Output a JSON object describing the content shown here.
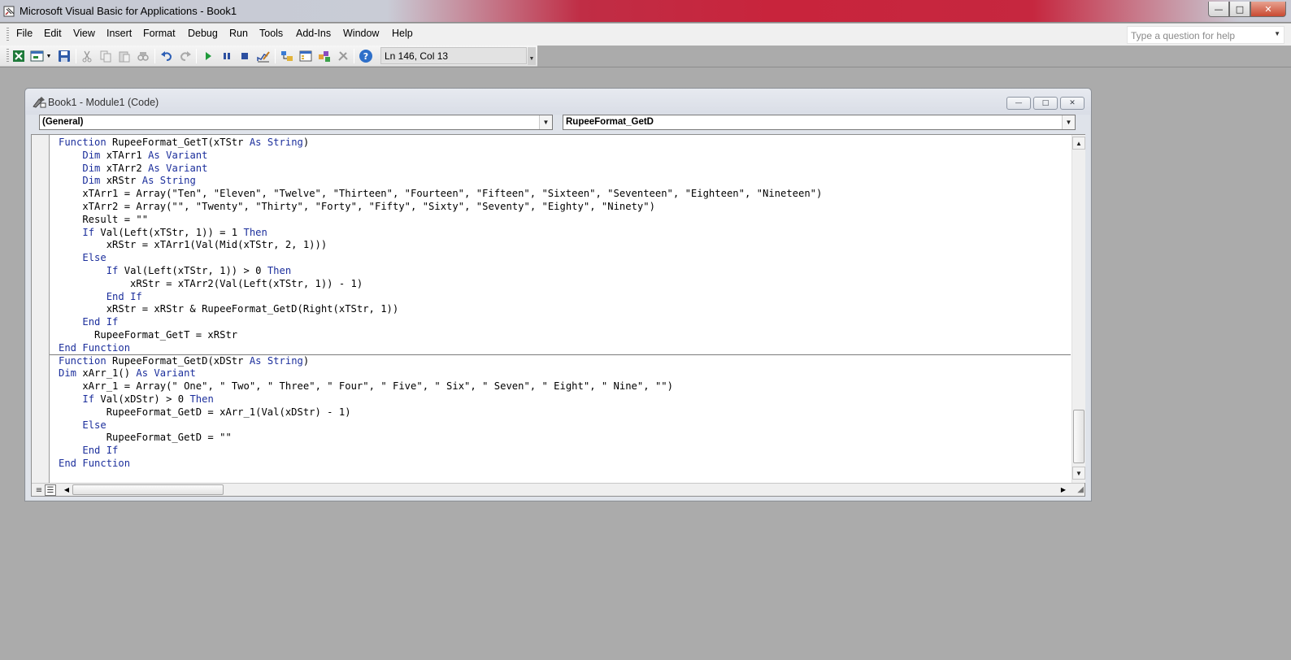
{
  "window": {
    "title": "Microsoft Visual Basic for Applications - Book1",
    "minimize_glyph": "—",
    "maximize_glyph": "□",
    "close_glyph": "✕"
  },
  "menu": {
    "items": [
      "File",
      "Edit",
      "View",
      "Insert",
      "Format",
      "Debug",
      "Run",
      "Tools",
      "Add-Ins",
      "Window",
      "Help"
    ],
    "help_placeholder": "Type a question for help"
  },
  "toolbar": {
    "icons": [
      "excel-view-icon",
      "insert-userform-icon",
      "dropdown-arrow-icon",
      "save-icon",
      "cut-icon",
      "copy-icon",
      "paste-icon",
      "find-icon",
      "undo-icon",
      "redo-icon",
      "run-icon",
      "break-icon",
      "reset-icon",
      "design-mode-icon",
      "project-explorer-icon",
      "properties-window-icon",
      "object-browser-icon",
      "toolbox-icon",
      "help-icon"
    ],
    "status": "Ln 146, Col 13"
  },
  "code_window": {
    "title": "Book1 - Module1 (Code)",
    "object_combo": "(General)",
    "procedure_combo": "RupeeFormat_GetD",
    "code_lines": [
      "Function RupeeFormat_GetT(xTStr As String)",
      "    Dim xTArr1 As Variant",
      "    Dim xTArr2 As Variant",
      "    Dim xRStr As String",
      "    xTArr1 = Array(\"Ten\", \"Eleven\", \"Twelve\", \"Thirteen\", \"Fourteen\", \"Fifteen\", \"Sixteen\", \"Seventeen\", \"Eighteen\", \"Nineteen\")",
      "    xTArr2 = Array(\"\", \"Twenty\", \"Thirty\", \"Forty\", \"Fifty\", \"Sixty\", \"Seventy\", \"Eighty\", \"Ninety\")",
      "    Result = \"\"",
      "    If Val(Left(xTStr, 1)) = 1 Then",
      "        xRStr = xTArr1(Val(Mid(xTStr, 2, 1)))",
      "    Else",
      "        If Val(Left(xTStr, 1)) > 0 Then",
      "            xRStr = xTArr2(Val(Left(xTStr, 1)) - 1)",
      "        End If",
      "        xRStr = xRStr & RupeeFormat_GetD(Right(xTStr, 1))",
      "    End If",
      "      RupeeFormat_GetT = xRStr",
      "End Function",
      "Function RupeeFormat_GetD(xDStr As String)",
      "Dim xArr_1() As Variant",
      "    xArr_1 = Array(\" One\", \" Two\", \" Three\", \" Four\", \" Five\", \" Six\", \" Seven\", \" Eight\", \" Nine\", \"\")",
      "    If Val(xDStr) > 0 Then",
      "        RupeeFormat_GetD = xArr_1(Val(xDStr) - 1)",
      "    Else",
      "        RupeeFormat_GetD = \"\"",
      "    End If",
      "End Function"
    ],
    "keywords": [
      "Function",
      "As",
      "String",
      "Dim",
      "Variant",
      "If",
      "Then",
      "Else",
      "End"
    ]
  },
  "colors": {
    "keyword": "#1c2f9c",
    "workspace": "#ababab"
  }
}
